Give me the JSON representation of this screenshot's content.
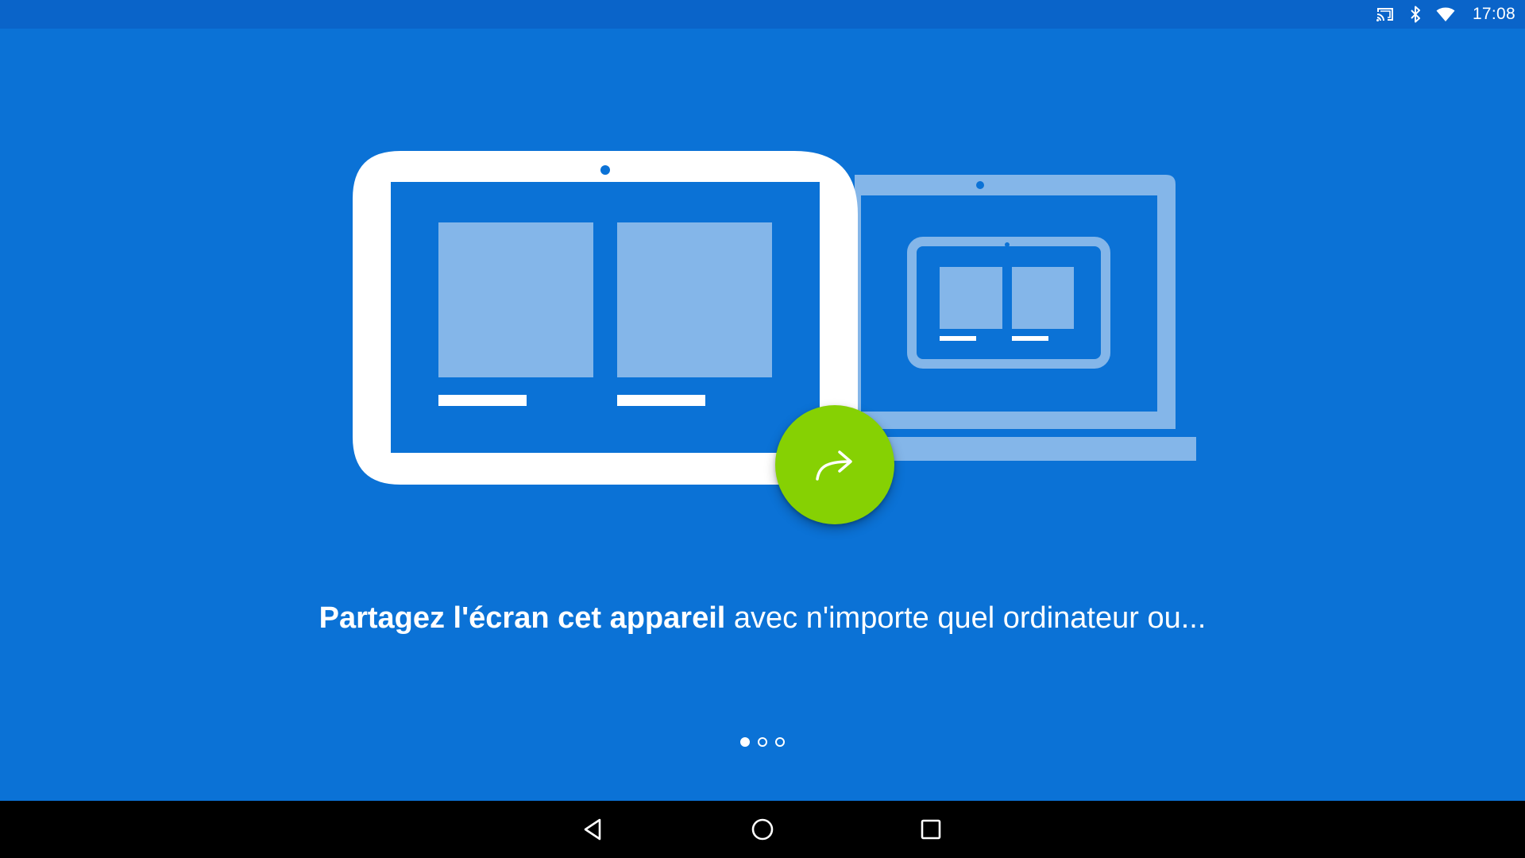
{
  "status_bar": {
    "time": "17:08",
    "icons": [
      "cast-icon",
      "bluetooth-icon",
      "wifi-icon"
    ]
  },
  "caption": {
    "bold": "Partagez l'écran cet appareil",
    "regular": " avec n'importe quel ordinateur ou..."
  },
  "pager": {
    "total": 3,
    "current": 1
  },
  "share_button": {
    "icon": "share-arrow-icon"
  },
  "nav_bar": {
    "buttons": [
      "back-icon",
      "home-icon",
      "recents-icon"
    ]
  },
  "colors": {
    "background": "#0b72d6",
    "status_bar": "#0a64c9",
    "fab": "#86d103",
    "device_light": "#84b6e9",
    "white": "#ffffff"
  }
}
